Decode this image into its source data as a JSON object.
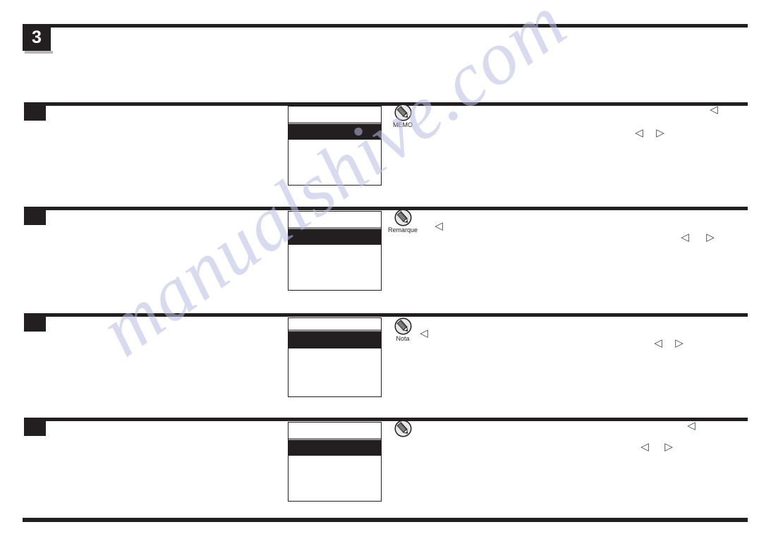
{
  "page": {
    "step_number": "3",
    "watermark": "manualshive.com",
    "ink_color": "#231f20",
    "watermark_color": "#b9bce4"
  },
  "sections": [
    {
      "id": "section-memo",
      "language": "english",
      "memo_label": "MEMO",
      "memo_icon": "pencil-memo-icon",
      "lcd": {
        "name": "lcd-screen-illustration",
        "top_row_height": 22,
        "separator": true,
        "band_height": 22
      },
      "arrows": [
        {
          "name": "arrow-left-top",
          "glyph": "◁"
        },
        {
          "name": "arrow-left-bottom",
          "glyph": "◁"
        },
        {
          "name": "arrow-right-bottom",
          "glyph": "▷"
        }
      ]
    },
    {
      "id": "section-remarque",
      "language": "french",
      "memo_label": "Remarque",
      "memo_icon": "pencil-memo-icon",
      "lcd": {
        "name": "lcd-screen-illustration",
        "top_row_height": 22,
        "separator": true,
        "band_height": 22
      },
      "arrows": [
        {
          "name": "arrow-left-inline",
          "glyph": "◁"
        },
        {
          "name": "arrow-left-bottom",
          "glyph": "◁"
        },
        {
          "name": "arrow-right-bottom",
          "glyph": "▷"
        }
      ]
    },
    {
      "id": "section-nota",
      "language": "spanish",
      "memo_label": "Nota",
      "memo_icon": "pencil-memo-icon",
      "lcd": {
        "name": "lcd-screen-illustration",
        "top_row_height": 16,
        "separator": true,
        "band_height": 24
      },
      "arrows": [
        {
          "name": "arrow-left-inline",
          "glyph": "◁"
        },
        {
          "name": "arrow-left-bottom",
          "glyph": "◁"
        },
        {
          "name": "arrow-right-bottom",
          "glyph": "▷"
        }
      ]
    },
    {
      "id": "section-unlabeled",
      "language": "other",
      "memo_label": "",
      "memo_icon": "pencil-memo-icon",
      "lcd": {
        "name": "lcd-screen-illustration",
        "top_row_height": 22,
        "separator": true,
        "band_height": 22
      },
      "arrows": [
        {
          "name": "arrow-left-top",
          "glyph": "◁"
        },
        {
          "name": "arrow-left-bottom",
          "glyph": "◁"
        },
        {
          "name": "arrow-right-bottom",
          "glyph": "▷"
        }
      ]
    }
  ]
}
